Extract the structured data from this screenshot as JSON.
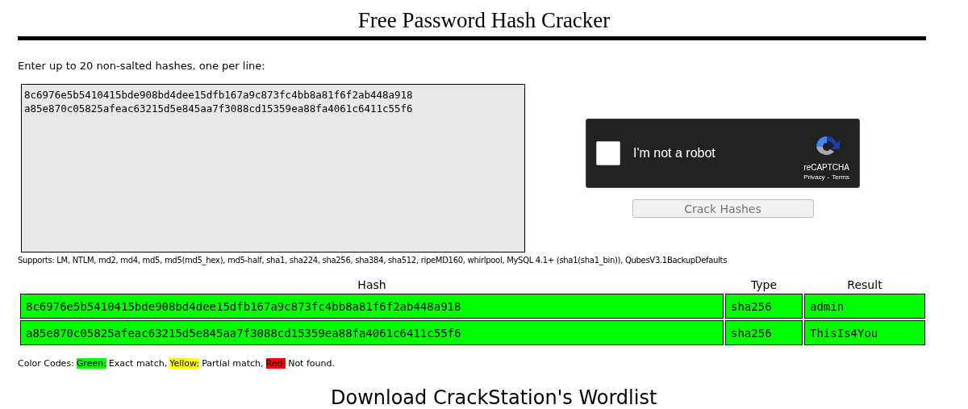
{
  "page": {
    "title": "Free Password Hash Cracker"
  },
  "input": {
    "label": "Enter up to 20 non-salted hashes, one per line:",
    "value": "8c6976e5b5410415bde908bd4dee15dfb167a9c873fc4bb8a81f6f2ab448a918\na85e870c05825afeac63215d5e845aa7f3088cd15359ea88fa4061c6411c55f6"
  },
  "captcha": {
    "label": "I'm not a robot",
    "checked": false,
    "brand": "reCAPTCHA",
    "privacy": "Privacy",
    "separator": "-",
    "terms": "Terms"
  },
  "submit_button": {
    "label": "Crack Hashes",
    "disabled": true
  },
  "supports": "Supports: LM, NTLM, md2, md4, md5, md5(md5_hex), md5-half, sha1, sha224, sha256, sha384, sha512, ripeMD160, whirlpool, MySQL 4.1+ (sha1(sha1_bin)), QubesV3.1BackupDefaults",
  "table": {
    "columns": [
      "Hash",
      "Type",
      "Result"
    ],
    "rows": [
      {
        "hash": "8c6976e5b5410415bde908bd4dee15dfb167a9c873fc4bb8a81f6f2ab448a918",
        "type": "sha256",
        "result": "admin",
        "color": "#00ff00"
      },
      {
        "hash": "a85e870c05825afeac63215d5e845aa7f3088cd15359ea88fa4061c6411c55f6",
        "type": "sha256",
        "result": "ThisIs4You",
        "color": "#00ff00"
      }
    ]
  },
  "color_codes": {
    "label": "Color Codes:",
    "items": [
      {
        "name": "Green:",
        "meaning": "Exact match,",
        "color": "#00ff00"
      },
      {
        "name": "Yellow:",
        "meaning": "Partial match,",
        "color": "#ffff00"
      },
      {
        "name": "Red:",
        "meaning": "Not found.",
        "color": "#ff0000"
      }
    ]
  },
  "next_heading": "Download CrackStation's Wordlist"
}
